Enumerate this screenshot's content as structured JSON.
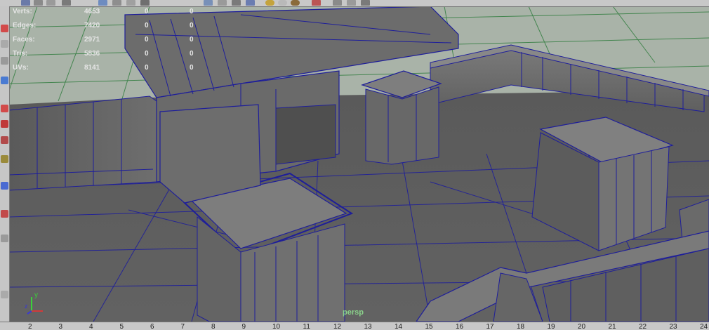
{
  "viewport": {
    "camera_label": "persp",
    "colors": {
      "floor": "#5e5e5e",
      "wall": "#737373",
      "wireframe": "#1e1e9a",
      "grid": "#2b7a3a",
      "grid_bg": "#a9b3a8",
      "hud_text": "#e6e6e6",
      "camera_label": "#8bd38b"
    }
  },
  "hud": {
    "rows": [
      {
        "label": "Verts:",
        "v1": "4653",
        "v2": "0",
        "v3": "0"
      },
      {
        "label": "Edges:",
        "v1": "7420",
        "v2": "0",
        "v3": "0"
      },
      {
        "label": "Faces:",
        "v1": "2971",
        "v2": "0",
        "v3": "0"
      },
      {
        "label": "Tris:",
        "v1": "5836",
        "v2": "0",
        "v3": "0"
      },
      {
        "label": "UVs:",
        "v1": "8141",
        "v2": "0",
        "v3": "0"
      }
    ]
  },
  "axis_indicator": {
    "y_label": "y",
    "z_label": "z"
  },
  "toolbox": {
    "tools": [
      "select-tool-icon",
      "move-tool-icon",
      "rotate-tool-icon",
      "scale-tool-icon",
      "soft-select-icon",
      "lasso-icon",
      "paint-icon",
      "snap-icon",
      "render-icon",
      "layout-icon",
      "view-icon",
      "panel-icon"
    ]
  },
  "timeline": {
    "ticks": [
      "2",
      "3",
      "4",
      "5",
      "6",
      "7",
      "8",
      "9",
      "10",
      "11",
      "12",
      "13",
      "14",
      "15",
      "16",
      "17",
      "18",
      "19",
      "20",
      "21",
      "22",
      "23",
      "24"
    ]
  }
}
